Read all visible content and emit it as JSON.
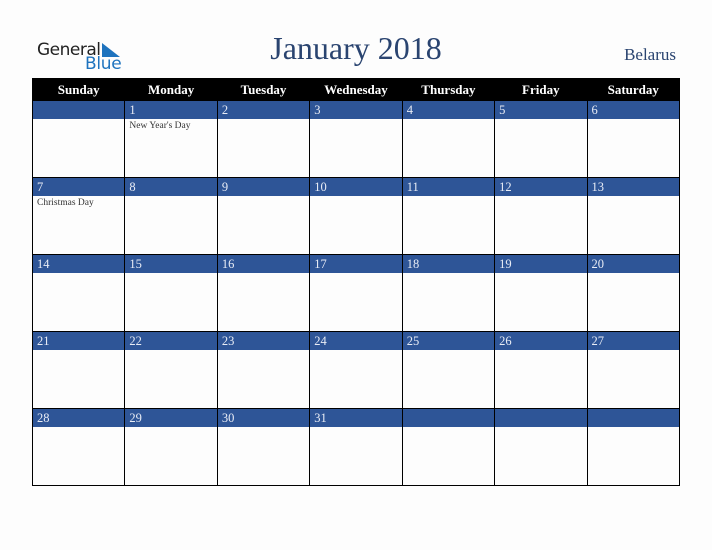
{
  "logo": {
    "word1": "General",
    "word2": "Blue",
    "brand_color": "#1e73be",
    "icon": "triangle-flag-icon"
  },
  "header": {
    "title": "January 2018",
    "country": "Belarus"
  },
  "colors": {
    "header_bg": "#000000",
    "date_bar": "#2e5597",
    "title_text": "#2a4470"
  },
  "weekdays": [
    "Sunday",
    "Monday",
    "Tuesday",
    "Wednesday",
    "Thursday",
    "Friday",
    "Saturday"
  ],
  "weeks": [
    [
      {
        "day": "",
        "holiday": ""
      },
      {
        "day": "1",
        "holiday": "New Year's Day"
      },
      {
        "day": "2",
        "holiday": ""
      },
      {
        "day": "3",
        "holiday": ""
      },
      {
        "day": "4",
        "holiday": ""
      },
      {
        "day": "5",
        "holiday": ""
      },
      {
        "day": "6",
        "holiday": ""
      }
    ],
    [
      {
        "day": "7",
        "holiday": "Christmas Day"
      },
      {
        "day": "8",
        "holiday": ""
      },
      {
        "day": "9",
        "holiday": ""
      },
      {
        "day": "10",
        "holiday": ""
      },
      {
        "day": "11",
        "holiday": ""
      },
      {
        "day": "12",
        "holiday": ""
      },
      {
        "day": "13",
        "holiday": ""
      }
    ],
    [
      {
        "day": "14",
        "holiday": ""
      },
      {
        "day": "15",
        "holiday": ""
      },
      {
        "day": "16",
        "holiday": ""
      },
      {
        "day": "17",
        "holiday": ""
      },
      {
        "day": "18",
        "holiday": ""
      },
      {
        "day": "19",
        "holiday": ""
      },
      {
        "day": "20",
        "holiday": ""
      }
    ],
    [
      {
        "day": "21",
        "holiday": ""
      },
      {
        "day": "22",
        "holiday": ""
      },
      {
        "day": "23",
        "holiday": ""
      },
      {
        "day": "24",
        "holiday": ""
      },
      {
        "day": "25",
        "holiday": ""
      },
      {
        "day": "26",
        "holiday": ""
      },
      {
        "day": "27",
        "holiday": ""
      }
    ],
    [
      {
        "day": "28",
        "holiday": ""
      },
      {
        "day": "29",
        "holiday": ""
      },
      {
        "day": "30",
        "holiday": ""
      },
      {
        "day": "31",
        "holiday": ""
      },
      {
        "day": "",
        "holiday": ""
      },
      {
        "day": "",
        "holiday": ""
      },
      {
        "day": "",
        "holiday": ""
      }
    ]
  ]
}
